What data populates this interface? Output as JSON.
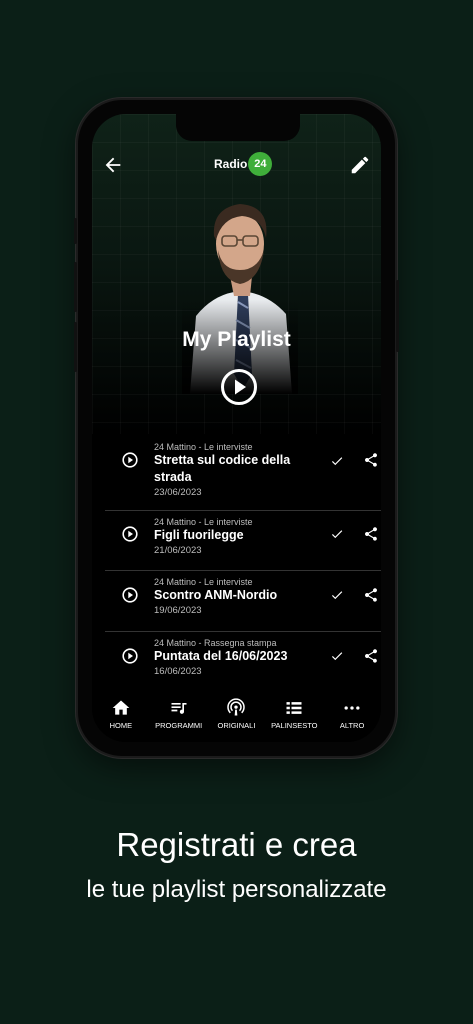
{
  "header": {
    "logo_text": "Radio",
    "logo_badge": "24"
  },
  "hero": {
    "title": "My Playlist"
  },
  "episodes": [
    {
      "meta": "24 Mattino - Le interviste",
      "title": "Stretta sul codice della strada",
      "date": "23/06/2023"
    },
    {
      "meta": "24 Mattino - Le interviste",
      "title": "Figli fuorilegge",
      "date": "21/06/2023"
    },
    {
      "meta": "24 Mattino - Le interviste",
      "title": "Scontro ANM-Nordio",
      "date": "19/06/2023"
    },
    {
      "meta": "24 Mattino - Rassegna stampa",
      "title": "Puntata del 16/06/2023",
      "date": "16/06/2023"
    }
  ],
  "tabs": [
    {
      "label": "HOME",
      "icon": "home-icon"
    },
    {
      "label": "PROGRAMMI",
      "icon": "programs-icon"
    },
    {
      "label": "ORIGINALI",
      "icon": "podcast-icon"
    },
    {
      "label": "PALINSESTO",
      "icon": "schedule-icon"
    },
    {
      "label": "ALTRO",
      "icon": "more-icon"
    }
  ],
  "caption": {
    "line1": "Registrati e crea",
    "line2": "le tue playlist personalizzate"
  },
  "colors": {
    "background": "#0b1f17",
    "brand_green": "#3fae3a"
  }
}
